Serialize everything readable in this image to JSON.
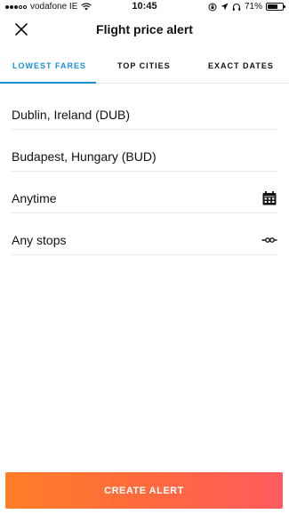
{
  "status_bar": {
    "carrier": "vodafone IE",
    "time": "10:45",
    "battery_percent": "71%",
    "battery_level": 0.71
  },
  "header": {
    "title": "Flight price alert",
    "close_icon": "close-icon"
  },
  "tabs": [
    {
      "label": "LOWEST FARES",
      "active": true
    },
    {
      "label": "TOP CITIES",
      "active": false
    },
    {
      "label": "EXACT DATES",
      "active": false
    }
  ],
  "form": {
    "origin": "Dublin, Ireland (DUB)",
    "destination": "Budapest, Hungary (BUD)",
    "dates": "Anytime",
    "stops": "Any stops",
    "dates_icon": "calendar-icon",
    "stops_icon": "stops-icon"
  },
  "footer": {
    "create_alert_label": "CREATE ALERT"
  },
  "colors": {
    "accent": "#1a8fd6",
    "button_gradient_start": "#ff7e28",
    "button_gradient_end": "#ff5b5e"
  }
}
